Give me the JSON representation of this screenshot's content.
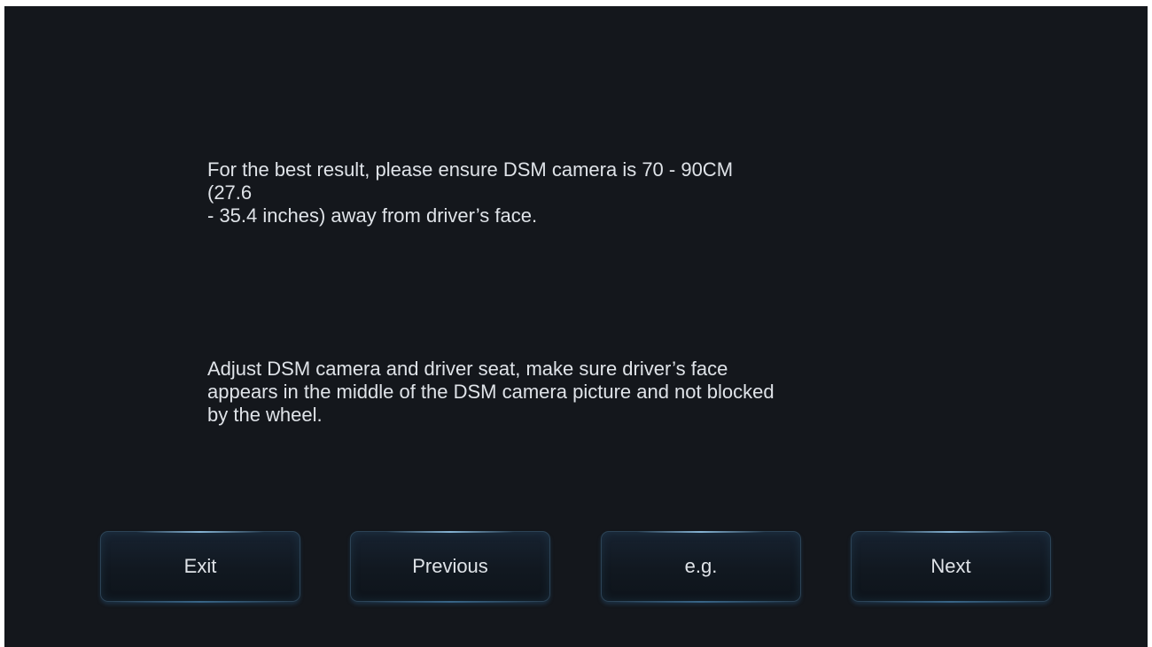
{
  "instructions": {
    "distance_lines": [
      "For the best result, please ensure DSM camera is 70 - 90CM",
      "(27.6",
      "- 35.4 inches) away from driver’s face."
    ],
    "position_lines": [
      "Adjust DSM camera and driver seat, make sure driver’s face",
      "appears in the middle of the DSM camera picture and not blocked",
      "by the wheel."
    ]
  },
  "buttons": {
    "exit_label": "Exit",
    "previous_label": "Previous",
    "example_label": "e.g.",
    "next_label": "Next"
  },
  "colors": {
    "background": "#14171c",
    "text": "#dfe3e8",
    "button_border": "#2c4356"
  }
}
